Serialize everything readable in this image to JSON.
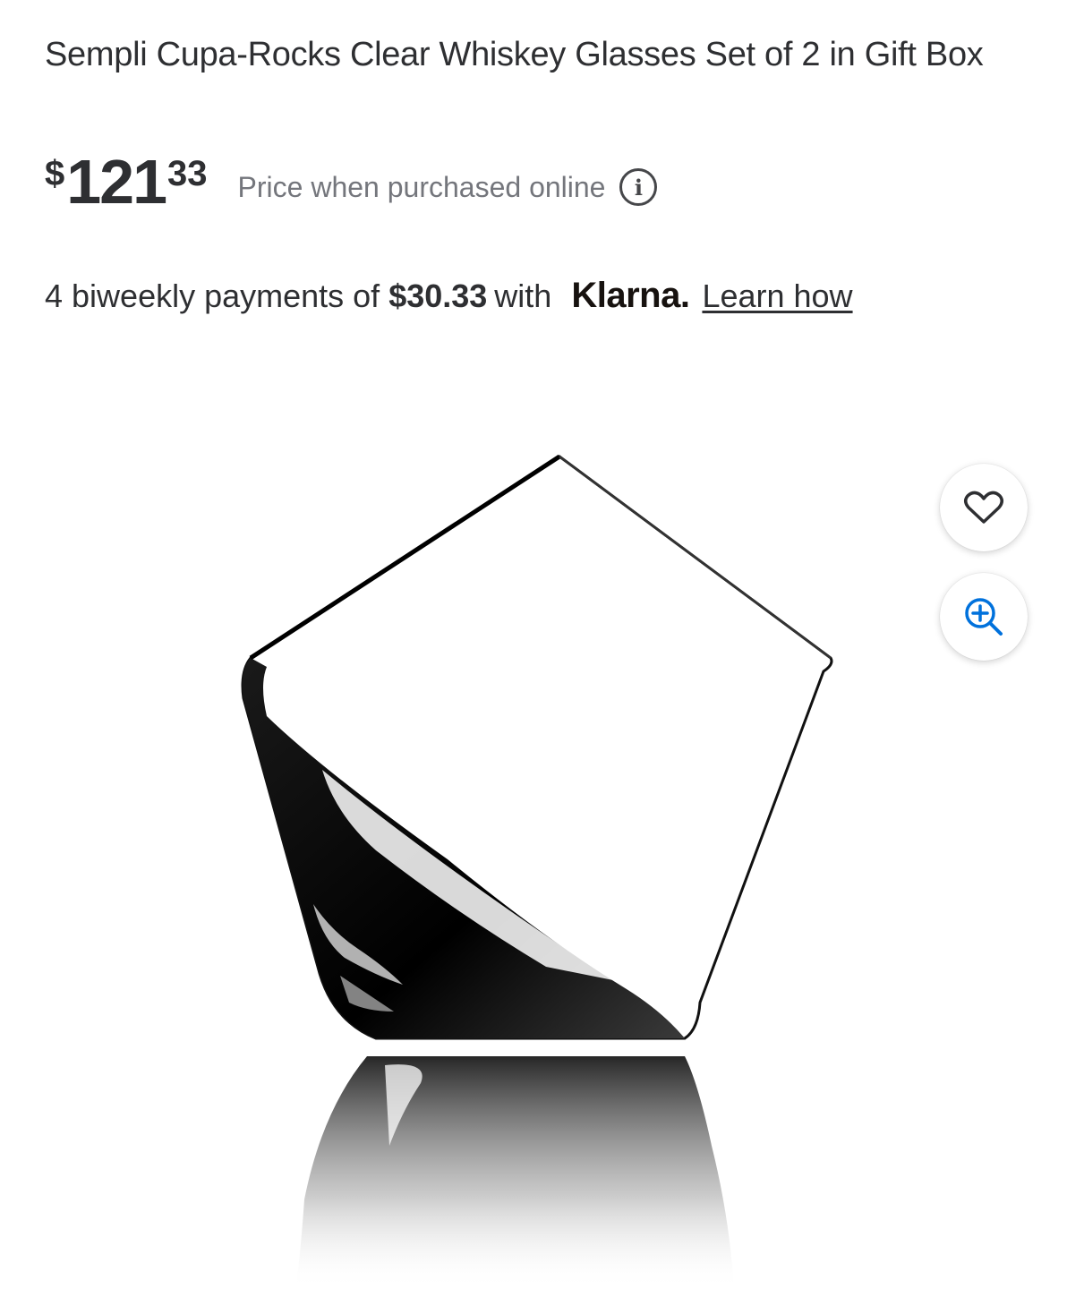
{
  "product": {
    "title": "Sempli Cupa-Rocks Clear Whiskey Glasses Set of 2 in Gift Box"
  },
  "price": {
    "currency": "$",
    "dollars": "121",
    "cents": "33",
    "note": "Price when purchased online",
    "info_icon": "i"
  },
  "klarna": {
    "prefix": "4 biweekly payments of",
    "amount": "$30.33",
    "with": "with",
    "brand": "Klarna.",
    "link": "Learn how"
  },
  "image": {
    "icons": [
      "heart-icon",
      "zoom-in-icon"
    ]
  }
}
